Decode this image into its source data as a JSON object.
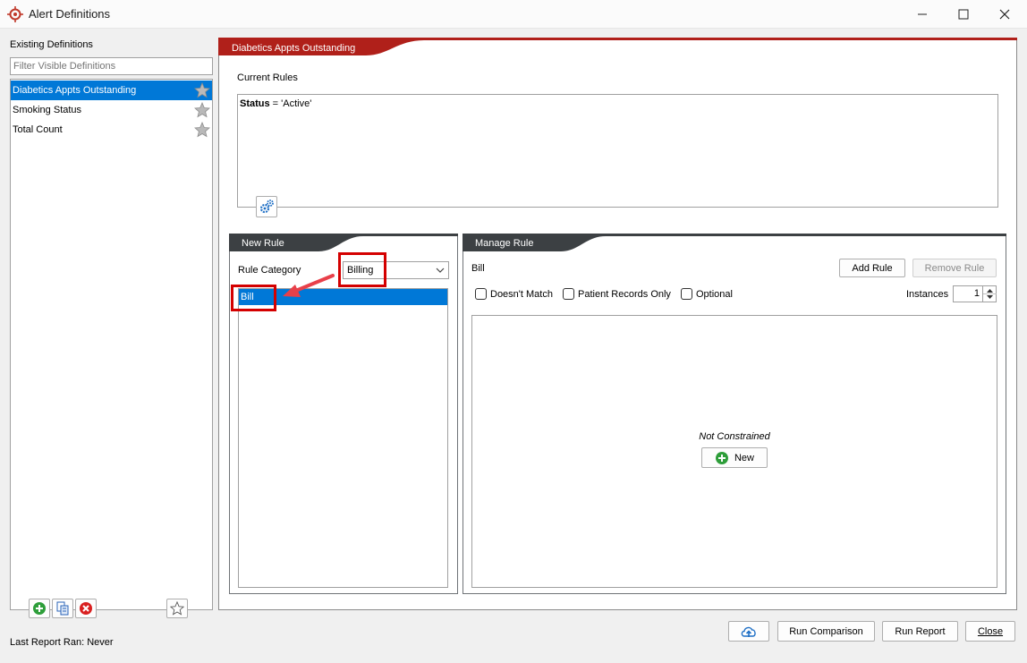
{
  "window": {
    "title": "Alert Definitions"
  },
  "left": {
    "heading": "Existing Definitions",
    "filter_placeholder": "Filter Visible Definitions",
    "items": [
      {
        "label": "Diabetics Appts Outstanding",
        "selected": true
      },
      {
        "label": "Smoking Status",
        "selected": false
      },
      {
        "label": "Total Count",
        "selected": false
      }
    ],
    "last_report": "Last Report Ran: Never"
  },
  "definition": {
    "title": "Diabetics Appts Outstanding",
    "current_rules_label": "Current Rules",
    "rule_field": "Status",
    "rule_rest": " = 'Active'"
  },
  "new_rule": {
    "tab": "New Rule",
    "category_label": "Rule Category",
    "category_value": "Billing",
    "items": [
      "Bill"
    ]
  },
  "manage_rule": {
    "tab": "Manage Rule",
    "rule_name": "Bill",
    "add_label": "Add Rule",
    "remove_label": "Remove Rule",
    "doesnt_match": "Doesn't Match",
    "patient_records_only": "Patient Records Only",
    "optional": "Optional",
    "instances_label": "Instances",
    "instances_value": "1",
    "not_constrained": "Not Constrained",
    "new_label": "New"
  },
  "footer": {
    "run_comparison": "Run Comparison",
    "run_report": "Run Report",
    "close": "Close"
  },
  "colors": {
    "accent_red": "#b0201a",
    "dark_tab": "#3c4043",
    "selection": "#0078d7",
    "highlight_box": "#d40000"
  }
}
